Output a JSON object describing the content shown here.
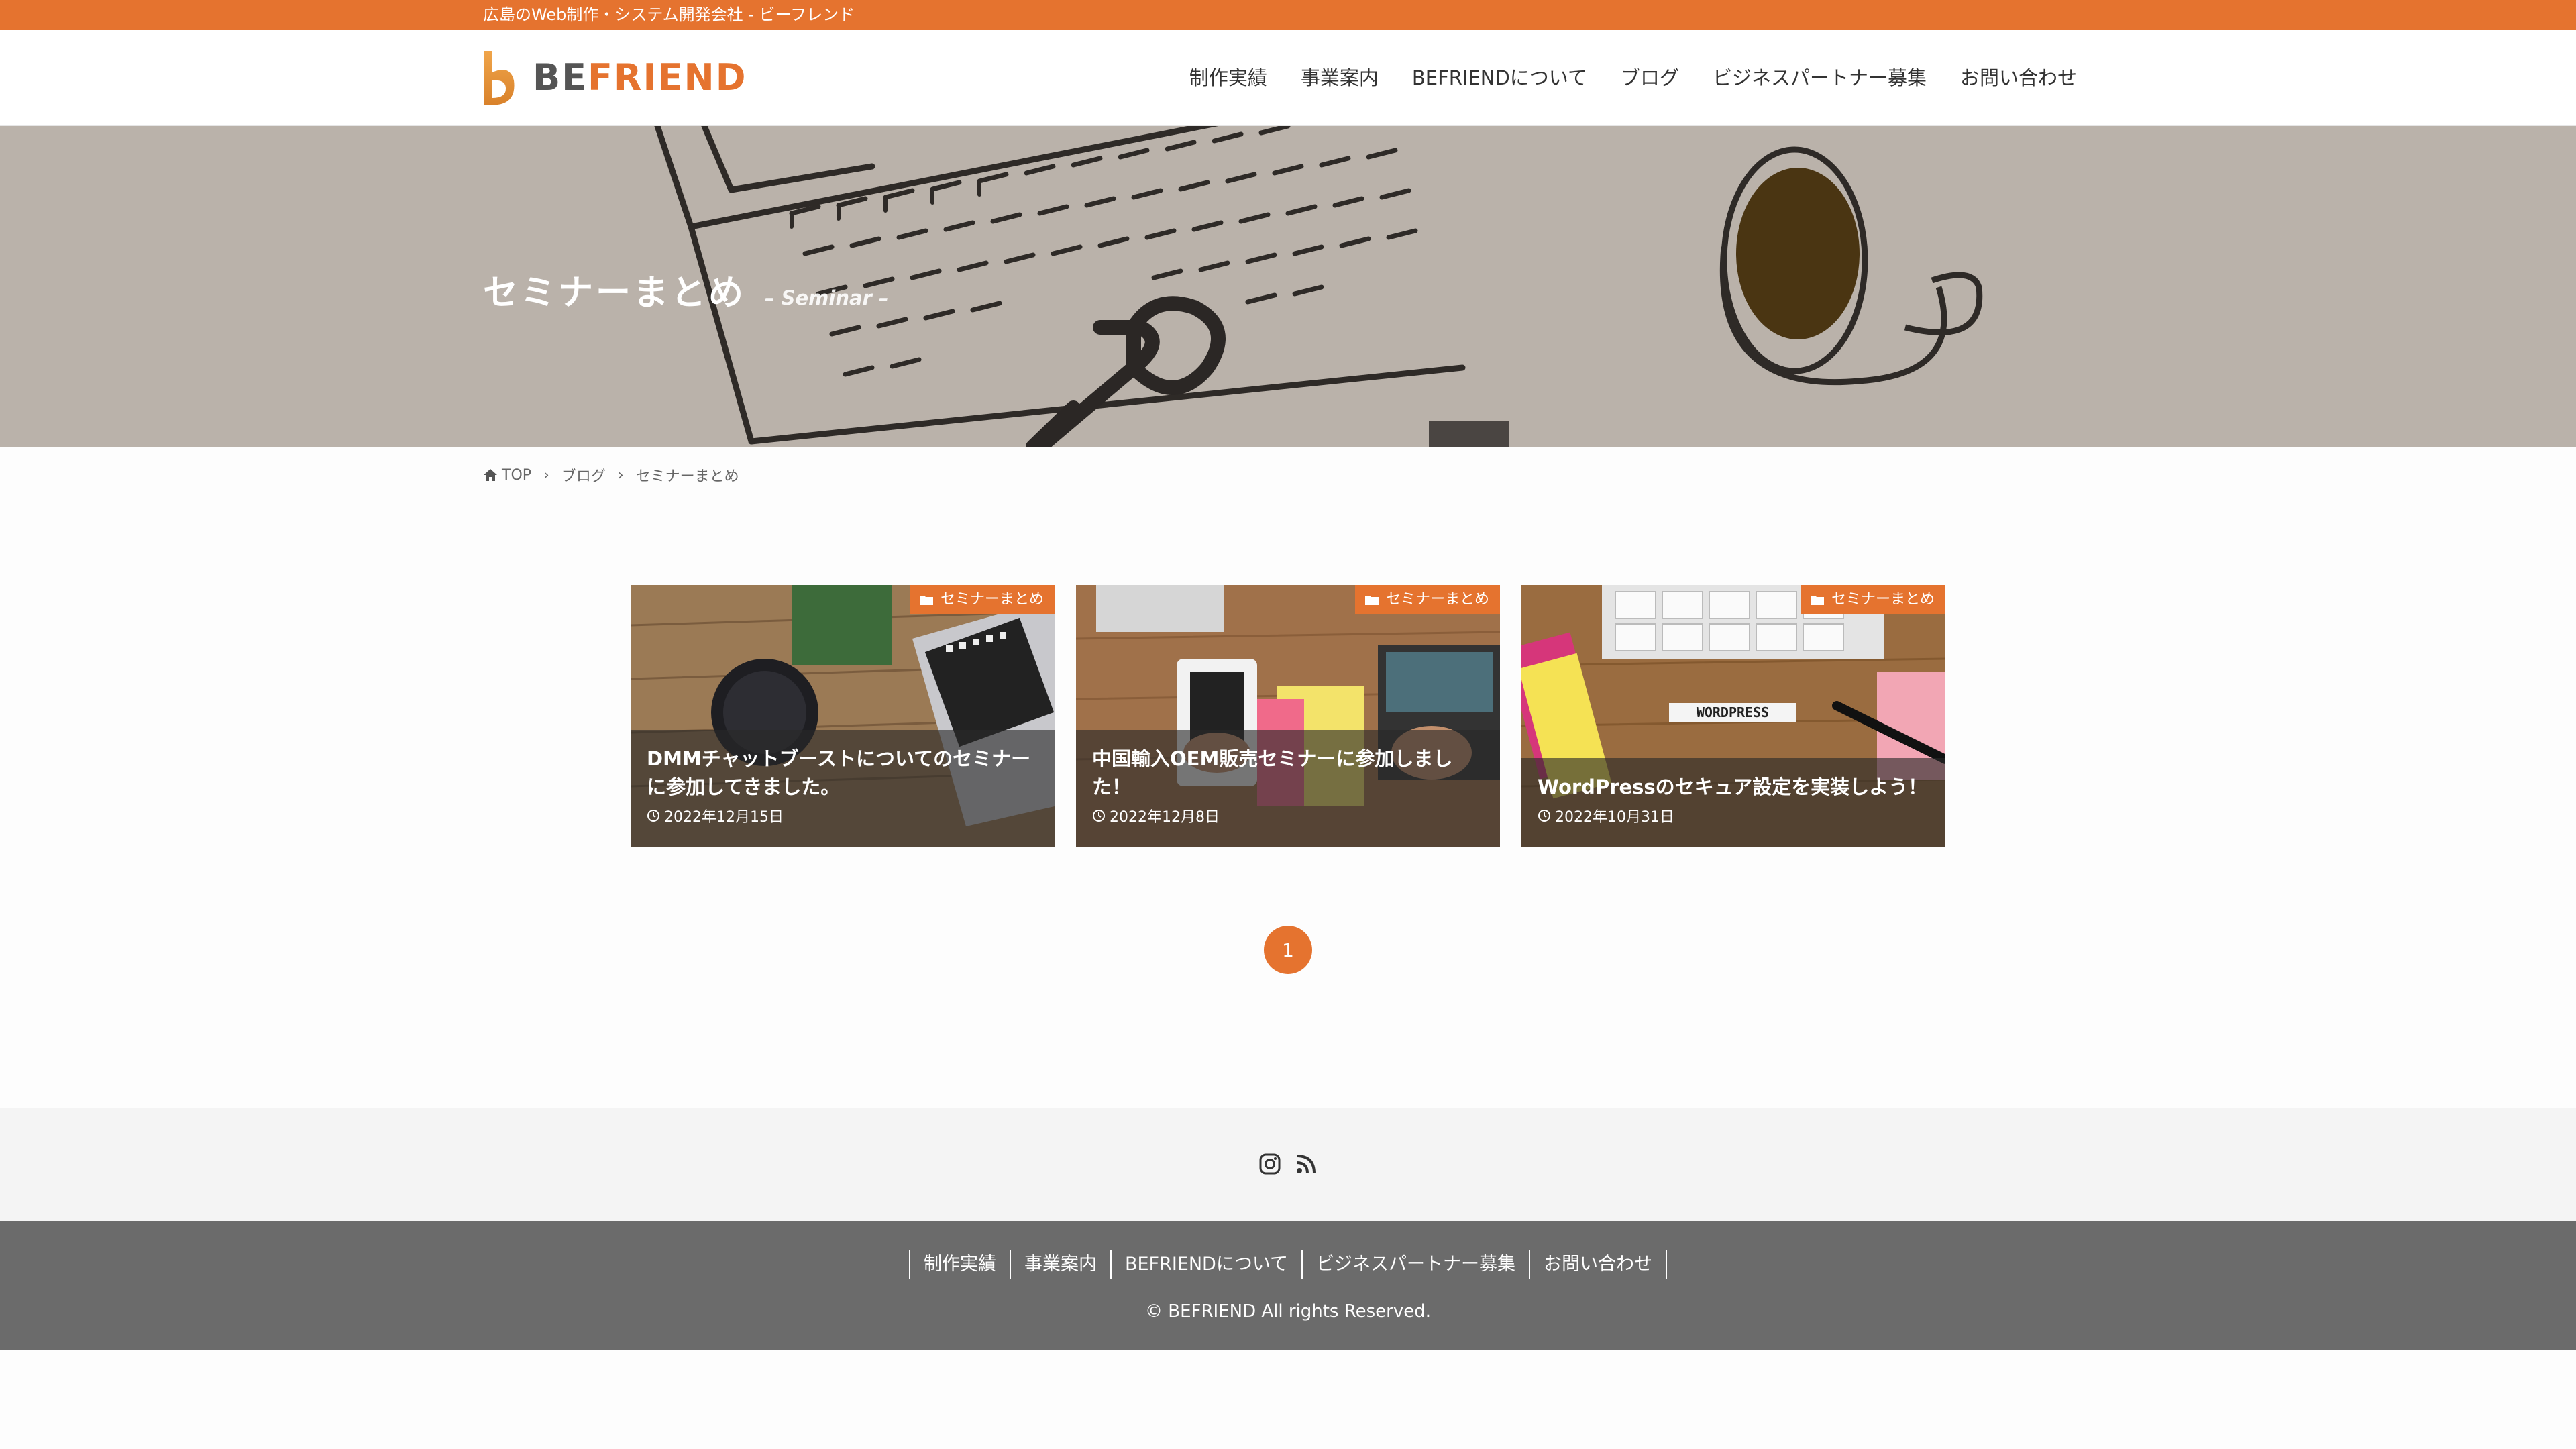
{
  "site": {
    "tagline": "広島のWeb制作・システム開発会社 - ビーフレンド",
    "logo_text_be": "BE",
    "logo_text_friend": "FRIEND"
  },
  "nav": {
    "items": [
      {
        "label": "制作実績"
      },
      {
        "label": "事業案内"
      },
      {
        "label": "BEFRIENDについて"
      },
      {
        "label": "ブログ"
      },
      {
        "label": "ビジネスパートナー募集"
      },
      {
        "label": "お問い合わせ"
      }
    ]
  },
  "hero": {
    "title": "セミナーまとめ",
    "subtitle": "– Seminar –"
  },
  "breadcrumb": [
    {
      "label": "TOP"
    },
    {
      "label": "ブログ"
    },
    {
      "label": "セミナーまとめ"
    }
  ],
  "posts": [
    {
      "category": "セミナーまとめ",
      "title": "DMMチャットブーストについてのセミナーに参加してきました。",
      "date": "2022年12月15日"
    },
    {
      "category": "セミナーまとめ",
      "title": "中国輸入OEM販売セミナーに参加しました！",
      "date": "2022年12月8日"
    },
    {
      "category": "セミナーまとめ",
      "title": "WordPressのセキュア設定を実装しよう！",
      "date": "2022年10月31日"
    }
  ],
  "pagination": {
    "current": "1"
  },
  "footer": {
    "nav": [
      {
        "label": "制作実績"
      },
      {
        "label": "事業案内"
      },
      {
        "label": "BEFRIENDについて"
      },
      {
        "label": "ビジネスパートナー募集"
      },
      {
        "label": "お問い合わせ"
      }
    ],
    "copyright": "© BEFRIEND All rights Reserved."
  },
  "colors": {
    "accent": "#e5732f",
    "footer_bg": "#6b6b6b",
    "social_bg": "#f4f4f4"
  },
  "thumbnail_overlay_text": "WORDPRESS"
}
